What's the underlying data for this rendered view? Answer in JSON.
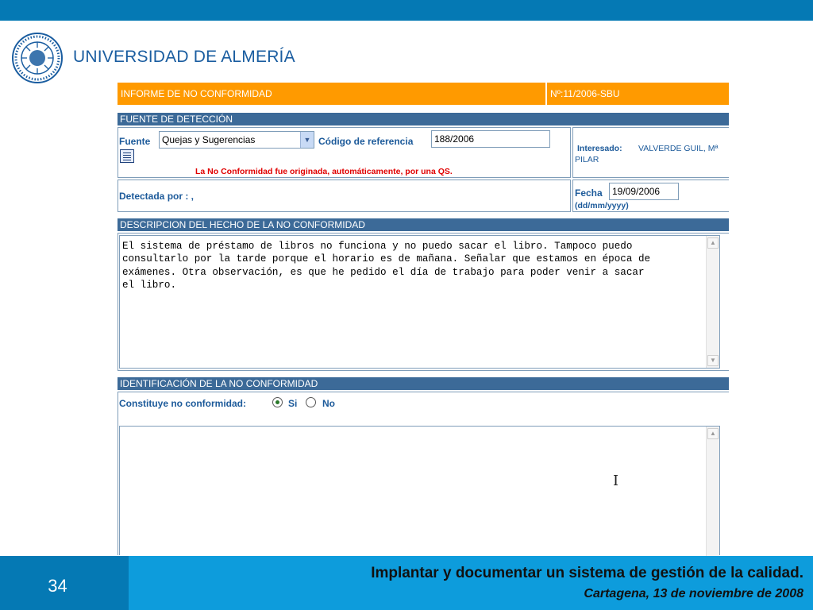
{
  "logo": {
    "name": "UNIVERSIDAD DE ALMERÍA",
    "seal_text": "IN LUMINE SAPIENTIA UNIVERSITAS ALMERIENSIS"
  },
  "form": {
    "report_title": "INFORME DE NO CONFORMIDAD",
    "report_number": "Nº:11/2006-SBU",
    "section_source": "FUENTE DE DETECCIÓN",
    "fuente_label": "Fuente",
    "fuente_value": "Quejas y Sugerencias",
    "codigo_label": "Código de referencia",
    "codigo_value": "188/2006",
    "interesado_label": "Interesado:",
    "interesado_value_1": "VALVERDE GUIL, Mª",
    "interesado_value_2": "PILAR",
    "auto_note": "La No Conformidad fue originada, automáticamente, por una QS.",
    "detectada_label": "Detectada por : ,",
    "fecha_label": "Fecha",
    "fecha_value": "19/09/2006",
    "fecha_format": "(dd/mm/yyyy)",
    "section_description": "DESCRIPCION DEL HECHO DE LA NO CONFORMIDAD",
    "description_text": "El sistema de préstamo de libros no funciona y no puedo sacar el libro. Tampoco puedo\nconsultarlo por la tarde porque el horario es de mañana. Señalar que estamos en época de\nexámenes. Otra observación, es que he pedido el día de trabajo para poder venir a sacar\nel libro.",
    "section_identification": "IDENTIFICACIÓN DE LA NO CONFORMIDAD",
    "constituye_label": "Constituye no conformidad:",
    "option_si": "Si",
    "option_no": "No",
    "selected_option": "Si"
  },
  "footer": {
    "slide_number": "34",
    "title": "Implantar y documentar un sistema de gestión de la calidad.",
    "subtitle": "Cartagena, 13 de noviembre de 2008"
  },
  "colors": {
    "top_band": "#0579B4",
    "orange_header": "#FF9A00",
    "section_header": "#3C6A98",
    "label_blue": "#1C5A9A",
    "note_red": "#E00000",
    "footer_light": "#0D9CDC"
  }
}
